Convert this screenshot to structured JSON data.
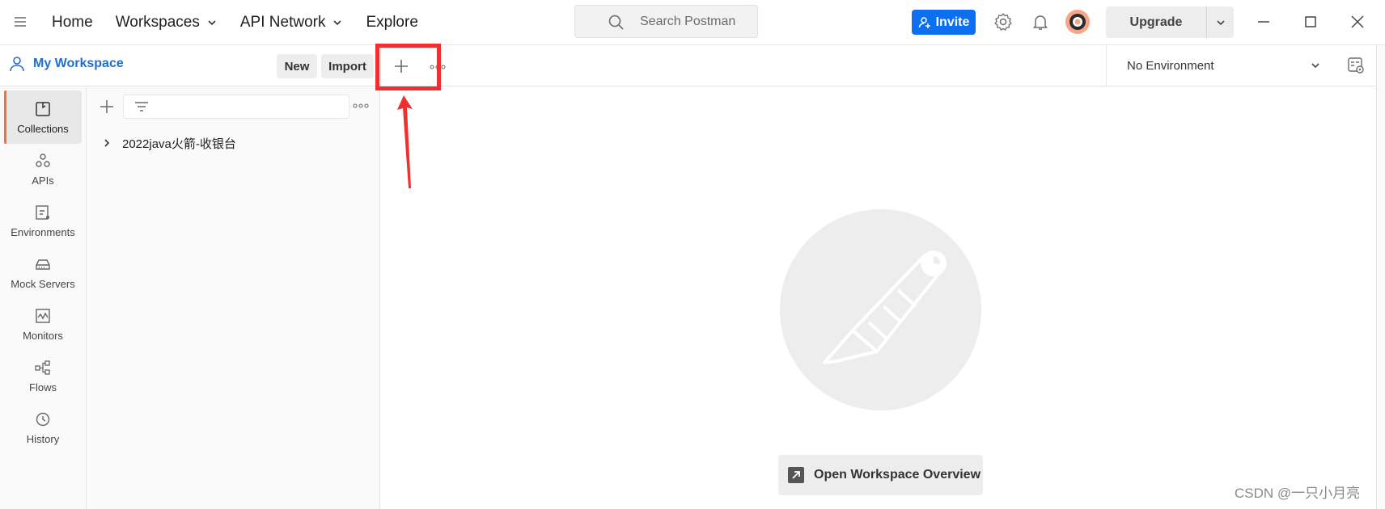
{
  "nav": {
    "home": "Home",
    "workspaces": "Workspaces",
    "api_network": "API Network",
    "explore": "Explore"
  },
  "search": {
    "placeholder": "Search Postman"
  },
  "header": {
    "invite_label": "Invite",
    "upgrade_label": "Upgrade"
  },
  "workspace": {
    "name": "My Workspace",
    "new_label": "New",
    "import_label": "Import"
  },
  "environment": {
    "selected": "No Environment"
  },
  "sidebar": {
    "items": [
      {
        "label": "Collections",
        "icon": "collections-icon",
        "active": true
      },
      {
        "label": "APIs",
        "icon": "apis-icon"
      },
      {
        "label": "Environments",
        "icon": "environments-icon"
      },
      {
        "label": "Mock Servers",
        "icon": "mock-servers-icon"
      },
      {
        "label": "Monitors",
        "icon": "monitors-icon"
      },
      {
        "label": "Flows",
        "icon": "flows-icon"
      },
      {
        "label": "History",
        "icon": "history-icon"
      }
    ]
  },
  "collections": {
    "items": [
      {
        "name": "2022java火箭-收银台"
      }
    ]
  },
  "main": {
    "overview_label": "Open Workspace Overview"
  },
  "watermark": "CSDN @一只小月亮",
  "colors": {
    "accent": "#0c6ff0",
    "workspace_link": "#1f6fd1",
    "active_marker": "#ff6c37",
    "annotation": "#ee3030"
  }
}
